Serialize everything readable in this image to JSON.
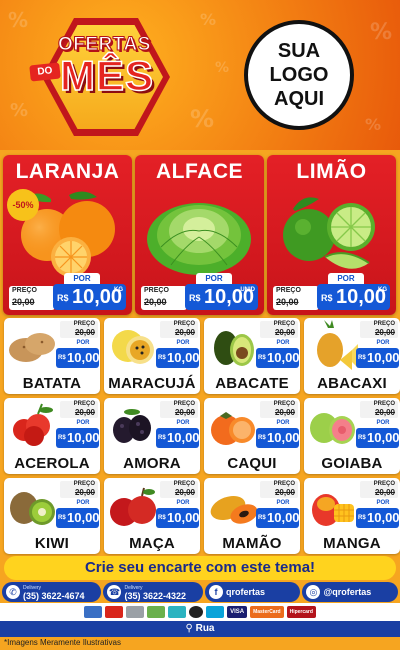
{
  "header": {
    "brand_top": "OFERTAS",
    "brand_do": "DO",
    "brand_main": "MÊS",
    "logo_lines": [
      "SUA",
      "LOGO",
      "AQUI"
    ]
  },
  "featured": [
    {
      "name": "LARANJA",
      "discount": "-50%",
      "por": "POR",
      "preco_label": "PREÇO",
      "old_price": "20,00",
      "currency": "R$",
      "price": "10,00",
      "unit": "KG",
      "icon": "orange"
    },
    {
      "name": "ALFACE",
      "discount": "",
      "por": "POR",
      "preco_label": "PREÇO",
      "old_price": "20,00",
      "currency": "R$",
      "price": "10,00",
      "unit": "UNID",
      "icon": "lettuce"
    },
    {
      "name": "LIMÃO",
      "discount": "",
      "por": "POR",
      "preco_label": "PREÇO",
      "old_price": "20,00",
      "currency": "R$",
      "price": "10,00",
      "unit": "KG",
      "icon": "lime"
    }
  ],
  "products": [
    {
      "name": "BATATA",
      "preco_label": "PREÇO",
      "old_price": "20,00",
      "por": "POR",
      "currency": "R$",
      "price": "10,00",
      "icon": "potato"
    },
    {
      "name": "MARACUJÁ",
      "preco_label": "PREÇO",
      "old_price": "20,00",
      "por": "POR",
      "currency": "R$",
      "price": "10,00",
      "icon": "passion-fruit"
    },
    {
      "name": "ABACATE",
      "preco_label": "PREÇO",
      "old_price": "20,00",
      "por": "POR",
      "currency": "R$",
      "price": "10,00",
      "icon": "avocado"
    },
    {
      "name": "ABACAXI",
      "preco_label": "PREÇO",
      "old_price": "20,00",
      "por": "POR",
      "currency": "R$",
      "price": "10,00",
      "icon": "pineapple"
    },
    {
      "name": "ACEROLA",
      "preco_label": "PREÇO",
      "old_price": "20,00",
      "por": "POR",
      "currency": "R$",
      "price": "10,00",
      "icon": "acerola"
    },
    {
      "name": "AMORA",
      "preco_label": "PREÇO",
      "old_price": "20,00",
      "por": "POR",
      "currency": "R$",
      "price": "10,00",
      "icon": "blackberry"
    },
    {
      "name": "CAQUI",
      "preco_label": "PREÇO",
      "old_price": "20,00",
      "por": "POR",
      "currency": "R$",
      "price": "10,00",
      "icon": "persimmon"
    },
    {
      "name": "GOIABA",
      "preco_label": "PREÇO",
      "old_price": "20,00",
      "por": "POR",
      "currency": "R$",
      "price": "10,00",
      "icon": "guava"
    },
    {
      "name": "KIWI",
      "preco_label": "PREÇO",
      "old_price": "20,00",
      "por": "POR",
      "currency": "R$",
      "price": "10,00",
      "icon": "kiwi"
    },
    {
      "name": "MAÇA",
      "preco_label": "PREÇO",
      "old_price": "20,00",
      "por": "POR",
      "currency": "R$",
      "price": "10,00",
      "icon": "apple"
    },
    {
      "name": "MAMÃO",
      "preco_label": "PREÇO",
      "old_price": "20,00",
      "por": "POR",
      "currency": "R$",
      "price": "10,00",
      "icon": "papaya"
    },
    {
      "name": "MANGA",
      "preco_label": "PREÇO",
      "old_price": "20,00",
      "por": "POR",
      "currency": "R$",
      "price": "10,00",
      "icon": "mango"
    }
  ],
  "cta": "Crie seu encarte com este tema!",
  "contacts": [
    {
      "label": "Delivery",
      "value": "(35) 3622-4674",
      "icon": "whatsapp-icon"
    },
    {
      "label": "Delivery",
      "value": "(35) 3622-4322",
      "icon": "phone-icon"
    },
    {
      "label": "",
      "value": "qrofertas",
      "icon": "facebook-icon"
    },
    {
      "label": "",
      "value": "@qrofertas",
      "icon": "instagram-icon"
    }
  ],
  "payments": [
    "VISA",
    "MasterCard",
    "Hipercard"
  ],
  "address": "Rua",
  "disclaimer": "*Imagens Meramente Ilustrativas",
  "colors": {
    "red": "#e42026",
    "blue": "#1458d6",
    "yellow": "#ffd31e",
    "orange_bg": "#f6a520"
  }
}
